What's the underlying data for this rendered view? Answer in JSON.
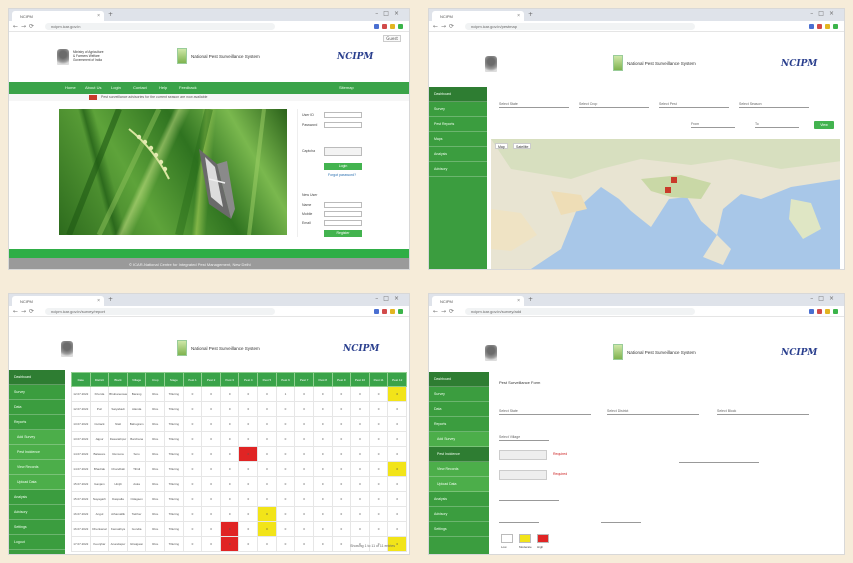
{
  "panel1": {
    "tab_title": "NCIPM",
    "url": "ncipm.icar.gov.in",
    "session": "Guest",
    "site_name": "National Pest Surveillance System",
    "ministry": [
      "Ministry of Agriculture",
      "& Farmers Welfare",
      "Government of India"
    ],
    "brand": "NCIPM",
    "nav": [
      "Home",
      "About Us",
      "Login",
      "Contact",
      "Help",
      "Feedback",
      "Sitemap"
    ],
    "ticker": "Pest surveillance advisories for the current season are now available",
    "login": {
      "user_label": "User ID",
      "pass_label": "Password",
      "captcha_label": "Captcha",
      "submit": "Login",
      "forgot": "Forgot password?"
    },
    "register": {
      "title": "New User",
      "name": "Name",
      "mobile": "Mobile",
      "email": "Email",
      "submit": "Register"
    },
    "footer": "© ICAR-National Centre for Integrated Pest Management, New Delhi"
  },
  "panel2": {
    "tab_title": "NCIPM",
    "url": "ncipm.icar.gov.in/pestmap",
    "brand": "NCIPM",
    "site_name": "National Pest Surveillance System",
    "sidebar": [
      "Dashboard",
      "Survey",
      "Pest Reports",
      "Maps",
      "Analysis",
      "Advisory"
    ],
    "filters": [
      "Select State",
      "Select Crop",
      "Select Pest",
      "Select Season"
    ],
    "date_from": "From",
    "date_to": "To",
    "view": "View",
    "map_buttons": [
      "Map",
      "Satellite"
    ]
  },
  "panel3": {
    "tab_title": "NCIPM",
    "url": "ncipm.icar.gov.in/survey/report",
    "brand": "NCIPM",
    "site_name": "National Pest Surveillance System",
    "sidebar": [
      "Dashboard",
      "Survey",
      "Data",
      "Reports",
      "Add Survey",
      "Pest Incidence",
      "View Records",
      "Upload Data",
      "Analysis",
      "Advisory",
      "Settings",
      "Logout"
    ],
    "headers": [
      "Date",
      "District",
      "Block",
      "Village",
      "Crop",
      "Stage",
      "Pest 1",
      "Pest 2",
      "Pest 3",
      "Pest 4",
      "Pest 5",
      "Pest 6",
      "Pest 7",
      "Pest 8",
      "Pest 9",
      "Pest 10",
      "Pest 11",
      "Pest 12"
    ],
    "rows": [
      [
        "12.07.2022",
        "Khurda",
        "Bhubaneswar",
        "Barang",
        "Rice",
        "Tillering",
        "0",
        "0",
        "0",
        "0",
        "0",
        "1",
        "0",
        "0",
        "0",
        "0",
        "0",
        "0"
      ],
      [
        "12.07.2022",
        "Puri",
        "Satyabadi",
        "Alanda",
        "Rice",
        "Tillering",
        "0",
        "0",
        "0",
        "0",
        "0",
        "0",
        "0",
        "0",
        "0",
        "0",
        "0",
        "0"
      ],
      [
        "13.07.2022",
        "Cuttack",
        "Niali",
        "Bahugram",
        "Rice",
        "Tillering",
        "0",
        "0",
        "0",
        "0",
        "0",
        "0",
        "0",
        "0",
        "0",
        "0",
        "0",
        "0"
      ],
      [
        "13.07.2022",
        "Jajpur",
        "Dasarathpur",
        "Barchana",
        "Rice",
        "Tillering",
        "0",
        "0",
        "0",
        "0",
        "0",
        "0",
        "0",
        "0",
        "0",
        "0",
        "0",
        "0"
      ],
      [
        "14.07.2022",
        "Balasore",
        "Remuna",
        "Soro",
        "Rice",
        "Tillering",
        "0",
        "0",
        "0",
        "0",
        "0",
        "0",
        "0",
        "0",
        "0",
        "0",
        "0",
        "0"
      ],
      [
        "14.07.2022",
        "Bhadrak",
        "Chandbali",
        "Tihidi",
        "Rice",
        "Tillering",
        "0",
        "0",
        "0",
        "0",
        "0",
        "0",
        "0",
        "0",
        "0",
        "0",
        "0",
        "0"
      ],
      [
        "15.07.2022",
        "Ganjam",
        "Hinjili",
        "Aska",
        "Rice",
        "Tillering",
        "0",
        "0",
        "0",
        "0",
        "0",
        "0",
        "0",
        "0",
        "0",
        "0",
        "0",
        "0"
      ],
      [
        "15.07.2022",
        "Nayagarh",
        "Daspalla",
        "Odagaon",
        "Rice",
        "Tillering",
        "0",
        "0",
        "0",
        "0",
        "0",
        "0",
        "0",
        "0",
        "0",
        "0",
        "0",
        "0"
      ],
      [
        "16.07.2022",
        "Angul",
        "Athamallik",
        "Talcher",
        "Rice",
        "Tillering",
        "0",
        "0",
        "0",
        "0",
        "0",
        "0",
        "0",
        "0",
        "0",
        "0",
        "0",
        "0"
      ],
      [
        "16.07.2022",
        "Dhenkanal",
        "Kamakhya",
        "Gondia",
        "Rice",
        "Tillering",
        "0",
        "0",
        "0",
        "0",
        "0",
        "0",
        "0",
        "0",
        "0",
        "0",
        "0",
        "0"
      ],
      [
        "17.07.2022",
        "Keonjhar",
        "Anandapur",
        "Ghatgaon",
        "Rice",
        "Tillering",
        "0",
        "0",
        "0",
        "0",
        "0",
        "0",
        "0",
        "0",
        "0",
        "0",
        "0",
        "0"
      ]
    ],
    "pager": "Showing 1 to 11 of 11 entries"
  },
  "panel4": {
    "tab_title": "NCIPM",
    "url": "ncipm.icar.gov.in/survey/add",
    "brand": "NCIPM",
    "site_name": "National Pest Surveillance System",
    "sidebar": [
      "Dashboard",
      "Survey",
      "Data",
      "Reports",
      "Add Survey",
      "Pest Incidence",
      "View Records",
      "Upload Data",
      "Analysis",
      "Advisory",
      "Settings"
    ],
    "title": "Pest Surveillance Form",
    "selects": [
      "Select State",
      "Select District",
      "Select Block",
      "Select Village"
    ],
    "warn1": "Required",
    "warn2": "Required",
    "legend": [
      "Low",
      "Moderate",
      "High"
    ]
  },
  "colors": {
    "accent": "#3aa349",
    "brand": "#2a3f8e",
    "alert_red": "#e02424",
    "alert_yellow": "#f2e419"
  }
}
